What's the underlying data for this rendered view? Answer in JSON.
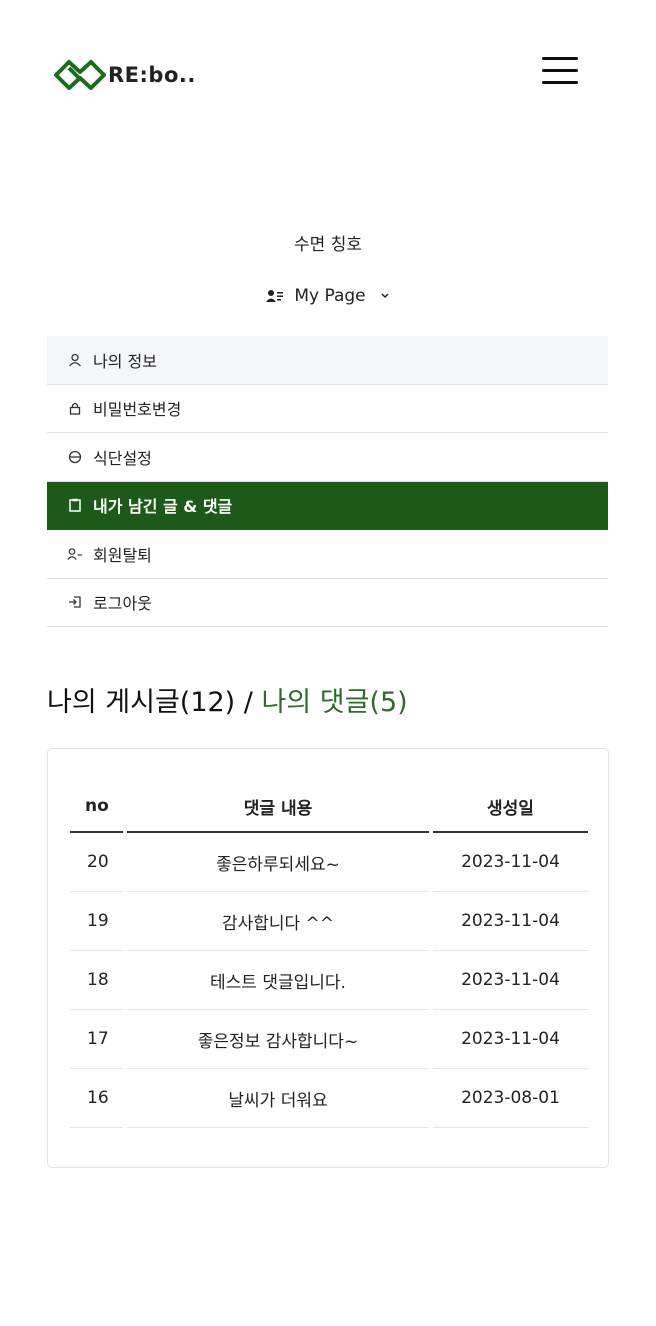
{
  "header": {
    "logo_text": "RE:bo..",
    "menu_icon": "hamburger-icon",
    "brand_color": "#1d5a19"
  },
  "profile": {
    "nickname": "수면 칭호",
    "mypage_label": "My Page",
    "mypage_icon": "person-lines-icon",
    "chevron_icon": "chevron-down-icon"
  },
  "menu": {
    "items": [
      {
        "label": "나의 정보",
        "icon": "person-icon",
        "state": "highlighted"
      },
      {
        "label": "비밀번호변경",
        "icon": "lock-icon",
        "state": "normal"
      },
      {
        "label": "식단설정",
        "icon": "plate-icon",
        "state": "normal"
      },
      {
        "label": "내가 남긴 글 & 댓글",
        "icon": "clipboard-icon",
        "state": "active"
      },
      {
        "label": "회원탈퇴",
        "icon": "person-dash-icon",
        "state": "normal"
      },
      {
        "label": "로그아웃",
        "icon": "logout-icon",
        "state": "normal"
      }
    ],
    "active_color": "#1d5a19"
  },
  "section": {
    "posts_label": "나의 게시글(12)",
    "separator": " / ",
    "comments_label": "나의 댓글(5)",
    "comments_color": "#2e6b2a"
  },
  "table": {
    "headers": [
      "no",
      "댓글 내용",
      "생성일"
    ],
    "rows": [
      [
        "20",
        "좋은하루되세요~",
        "2023-11-04"
      ],
      [
        "19",
        "감사합니다 ^^",
        "2023-11-04"
      ],
      [
        "18",
        "테스트 댓글입니다.",
        "2023-11-04"
      ],
      [
        "17",
        "좋은정보 감사합니다~",
        "2023-11-04"
      ],
      [
        "16",
        "날씨가 더워요",
        "2023-08-01"
      ]
    ]
  }
}
